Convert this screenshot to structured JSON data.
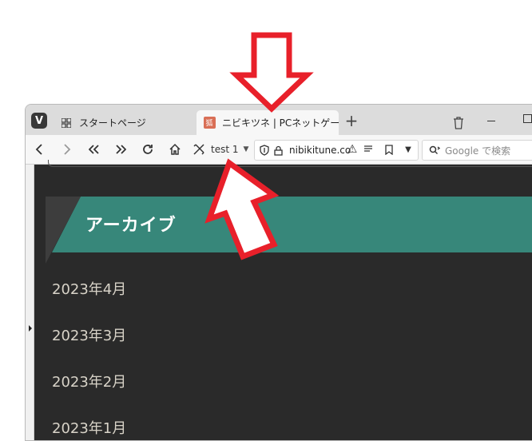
{
  "browser": {
    "tabs": [
      {
        "label": "スタートページ",
        "icon": "grid-icon"
      },
      {
        "label": "ニビキツネ | PCネットゲーム漫画",
        "icon": "site-favicon"
      }
    ],
    "toolbar": {
      "profile_label": "test 1",
      "url": "nibikitune.co",
      "search_placeholder": "Google で検索"
    }
  },
  "page": {
    "archive_title": "アーカイブ",
    "months": [
      "2023年4月",
      "2023年3月",
      "2023年2月",
      "2023年1月"
    ]
  },
  "colors": {
    "page_background": "#2a2a2a",
    "archive_header": "#37877a",
    "annotation_arrow": "#e8202a"
  }
}
